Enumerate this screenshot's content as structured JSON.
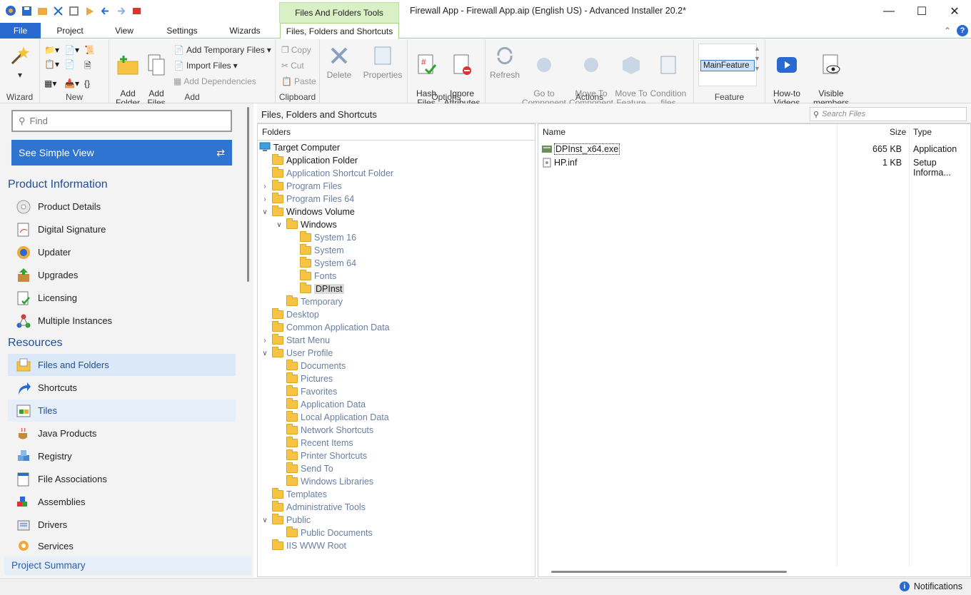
{
  "window": {
    "title": "Firewall App - Firewall App.aip (English US) - Advanced Installer 20.2*",
    "context_tab_group": "Files And Folders Tools"
  },
  "tabs": [
    "File",
    "Project",
    "View",
    "Settings",
    "Wizards",
    "Files, Folders and Shortcuts"
  ],
  "ribbon": {
    "groups": [
      "Wizard",
      "New",
      "Add",
      "Clipboard",
      "Options",
      "Actions",
      "Feature"
    ],
    "add_folder": "Add\nFolder",
    "add_files": "Add\nFiles",
    "add_temporary_files": "Add Temporary Files",
    "import_files": "Import Files",
    "add_dependencies": "Add Dependencies",
    "copy": "Copy",
    "cut": "Cut",
    "paste": "Paste",
    "delete": "Delete",
    "properties": "Properties",
    "hash_files": "Hash\nFiles",
    "ignore_attributes": "Ignore\nAttributes",
    "refresh": "Refresh",
    "go_to_component": "Go to\nComponent",
    "move_to_component": "Move To\nComponent",
    "move_to_feature": "Move To\nFeature",
    "condition_files": "Condition\nfiles",
    "feature_value": "MainFeature",
    "howto_videos": "How-to\nVideos",
    "visible_members": "Visible\nmembers"
  },
  "left": {
    "find_placeholder": "Find",
    "simple_view": "See Simple View",
    "product_info_header": "Product Information",
    "product_info_items": [
      "Product Details",
      "Digital Signature",
      "Updater",
      "Upgrades",
      "Licensing",
      "Multiple Instances"
    ],
    "resources_header": "Resources",
    "resources_items": [
      "Files and Folders",
      "Shortcuts",
      "Tiles",
      "Java Products",
      "Registry",
      "File Associations",
      "Assemblies",
      "Drivers",
      "Services"
    ],
    "summary": "Project Summary"
  },
  "main": {
    "title": "Files, Folders and Shortcuts",
    "search_placeholder": "Search Files",
    "folders_header": "Folders",
    "tree": [
      "Target Computer",
      "Application Folder",
      "Application Shortcut Folder",
      "Program Files",
      "Program Files 64",
      "Windows Volume",
      "Windows",
      "System 16",
      "System",
      "System 64",
      "Fonts",
      "DPInst",
      "Temporary",
      "Desktop",
      "Common Application Data",
      "Start Menu",
      "User Profile",
      "Documents",
      "Pictures",
      "Favorites",
      "Application Data",
      "Local Application Data",
      "Network Shortcuts",
      "Recent Items",
      "Printer Shortcuts",
      "Send To",
      "Windows Libraries",
      "Templates",
      "Administrative Tools",
      "Public",
      "Public Documents",
      "IIS WWW Root"
    ],
    "file_columns": {
      "name": "Name",
      "size": "Size",
      "type": "Type"
    },
    "files": [
      {
        "name": "DPInst_x64.exe",
        "size": "665 KB",
        "type": "Application"
      },
      {
        "name": "HP.inf",
        "size": "1 KB",
        "type": "Setup Informa..."
      }
    ]
  },
  "status": {
    "notifications": "Notifications"
  },
  "colors": {
    "accent": "#2a6ad0",
    "context_tab": "#d9f0c5",
    "folder": "#f7c343"
  }
}
